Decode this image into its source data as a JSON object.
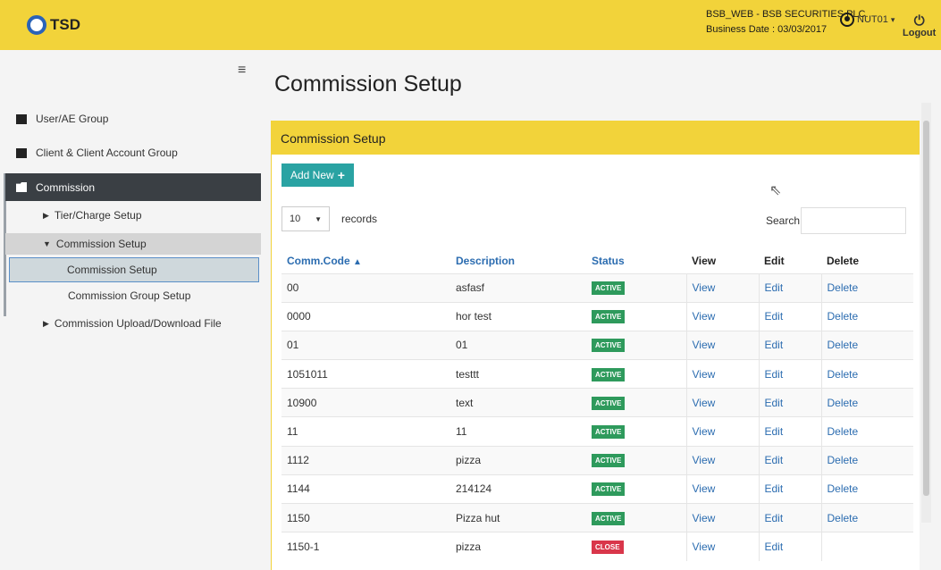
{
  "header": {
    "logo_text": "TSD",
    "company": "BSB_WEB - BSB SECURITIES PLC.",
    "business_date": "Business Date : 03/03/2017",
    "user": "NUT01",
    "logout": "Logout"
  },
  "sidebar": {
    "items": [
      {
        "label": "User/AE Group"
      },
      {
        "label": "Client & Client Account Group"
      },
      {
        "label": "Commission"
      }
    ],
    "sub_items": [
      {
        "label": "Tier/Charge Setup"
      },
      {
        "label": "Commission Setup"
      },
      {
        "label": "Commission Setup"
      },
      {
        "label": "Commission Group Setup"
      },
      {
        "label": "Commission Upload/Download File"
      }
    ]
  },
  "page": {
    "title": "Commission Setup",
    "panel_title": "Commission Setup",
    "add_new_label": "Add New",
    "page_length": "10",
    "records_label": "records",
    "search_label": "Search",
    "search_value": ""
  },
  "table": {
    "columns": [
      "Comm.Code",
      "Description",
      "Status",
      "View",
      "Edit",
      "Delete"
    ],
    "rows": [
      {
        "code": "00",
        "desc": "asfasf",
        "status": "ACTIVE",
        "view": "View",
        "edit": "Edit",
        "delete": "Delete"
      },
      {
        "code": "0000",
        "desc": "hor test",
        "status": "ACTIVE",
        "view": "View",
        "edit": "Edit",
        "delete": "Delete"
      },
      {
        "code": "01",
        "desc": "01",
        "status": "ACTIVE",
        "view": "View",
        "edit": "Edit",
        "delete": "Delete"
      },
      {
        "code": "1051011",
        "desc": "testtt",
        "status": "ACTIVE",
        "view": "View",
        "edit": "Edit",
        "delete": "Delete"
      },
      {
        "code": "10900",
        "desc": "text",
        "status": "ACTIVE",
        "view": "View",
        "edit": "Edit",
        "delete": "Delete"
      },
      {
        "code": "11",
        "desc": "11",
        "status": "ACTIVE",
        "view": "View",
        "edit": "Edit",
        "delete": "Delete"
      },
      {
        "code": "1112",
        "desc": "pizza",
        "status": "ACTIVE",
        "view": "View",
        "edit": "Edit",
        "delete": "Delete"
      },
      {
        "code": "1144",
        "desc": "214124",
        "status": "ACTIVE",
        "view": "View",
        "edit": "Edit",
        "delete": "Delete"
      },
      {
        "code": "1150",
        "desc": "Pizza hut",
        "status": "ACTIVE",
        "view": "View",
        "edit": "Edit",
        "delete": "Delete"
      },
      {
        "code": "1150-1",
        "desc": "pizza",
        "status": "CLOSE",
        "view": "View",
        "edit": "Edit",
        "delete": ""
      }
    ]
  },
  "colors": {
    "accent": "#f2d33a",
    "active_badge": "#2e9a5c",
    "close_badge": "#d9364a",
    "link": "#2b6cb0",
    "add_button": "#2aa3a3"
  }
}
